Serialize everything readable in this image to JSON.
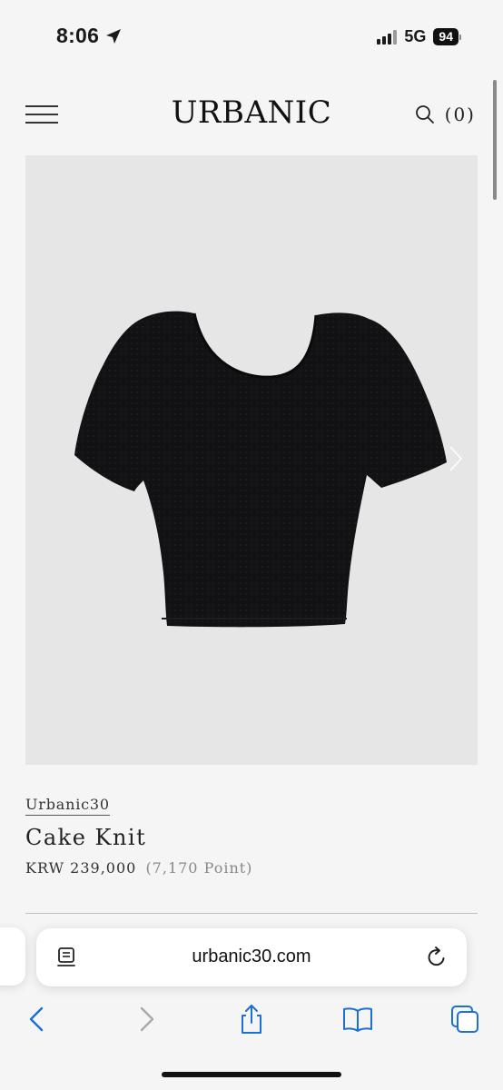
{
  "status_bar": {
    "time": "8:06",
    "network": "5G",
    "battery": "94"
  },
  "header": {
    "logo": "URBANIC",
    "cart_count": "(0)"
  },
  "product": {
    "brand": "Urbanic30",
    "name": "Cake Knit",
    "price": "KRW 239,000",
    "points": "(7,170 Point)"
  },
  "browser": {
    "url": "urbanic30.com"
  },
  "icons": {
    "menu": "hamburger-menu-icon",
    "search": "search-icon",
    "next": "chevron-right-icon",
    "reader": "reader-icon",
    "reload": "reload-icon",
    "back": "chevron-left-icon",
    "forward": "chevron-right-icon",
    "share": "share-icon",
    "bookmarks": "book-icon",
    "tabs": "tabs-icon"
  },
  "colors": {
    "accent": "#1b6fd8",
    "page_bg": "#f5f5f5",
    "image_bg": "#e6e6e6",
    "garment": "#121214"
  }
}
